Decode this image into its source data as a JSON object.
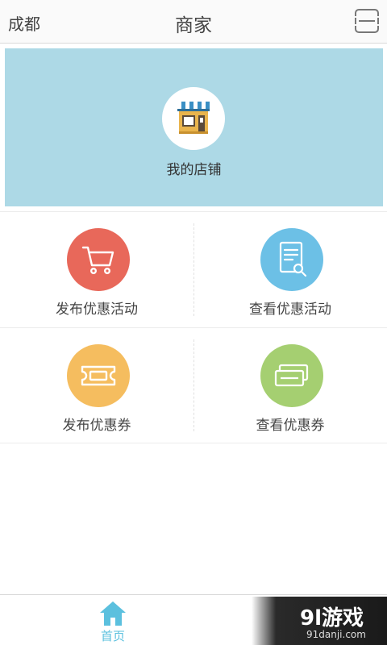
{
  "header": {
    "city": "成都",
    "title": "商家",
    "menu_icon": "menu-icon"
  },
  "shop": {
    "label": "我的店铺",
    "icon": "store-icon",
    "bg_color": "#add9e6"
  },
  "actions": [
    {
      "label": "发布优惠活动",
      "icon": "cart-icon",
      "color": "#e8685a"
    },
    {
      "label": "查看优惠活动",
      "icon": "document-search-icon",
      "color": "#6cc0e6"
    },
    {
      "label": "发布优惠券",
      "icon": "ticket-icon",
      "color": "#f5bd5f"
    },
    {
      "label": "查看优惠券",
      "icon": "tickets-icon",
      "color": "#a5cf71"
    }
  ],
  "bottom_nav": {
    "home_label": "首页",
    "home_icon": "home-icon",
    "active_color": "#5bc0de"
  },
  "watermark": {
    "main": "9l游戏",
    "sub": "91danji.com"
  }
}
